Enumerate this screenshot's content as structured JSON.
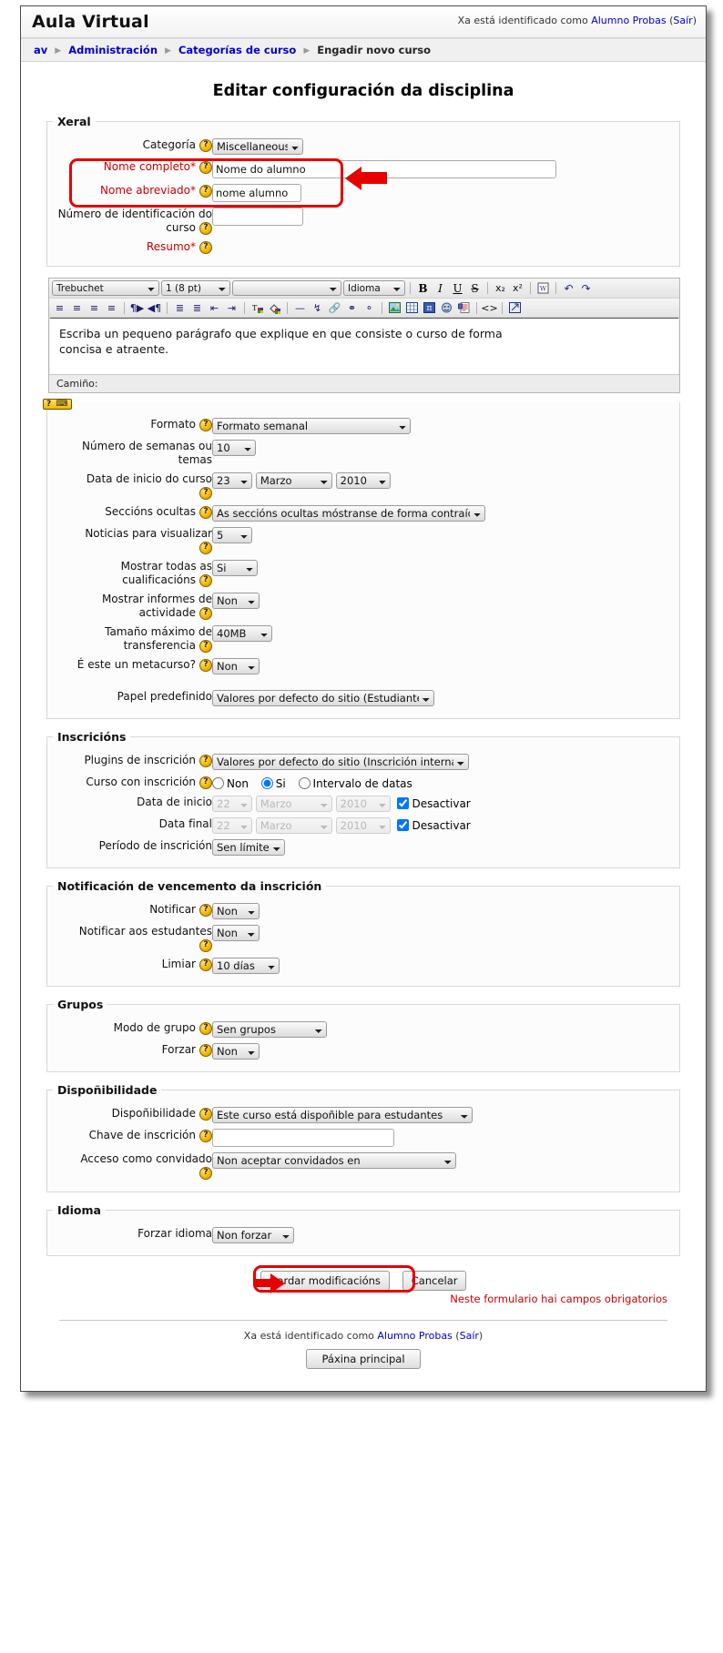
{
  "header": {
    "site_title": "Aula Virtual",
    "login_prefix": "Xa está identificado como",
    "user_name": "Alumno Probas",
    "logout_open": "(",
    "logout_label": "Saír",
    "logout_close": ")"
  },
  "breadcrumb": {
    "items": [
      {
        "label": "av",
        "link": true
      },
      {
        "label": "Administración",
        "link": true
      },
      {
        "label": "Categorías de curso",
        "link": true
      },
      {
        "label": "Engadir novo curso",
        "link": false
      }
    ],
    "separator": "▶"
  },
  "page": {
    "title": "Editar configuración da disciplina"
  },
  "sections": {
    "xeral": {
      "legend": "Xeral",
      "fields": {
        "categoria": {
          "label": "Categoría",
          "value": "Miscellaneous"
        },
        "nome_completo": {
          "label": "Nome completo",
          "star": "*",
          "value": "Nome do alumno"
        },
        "nome_abreviado": {
          "label": "Nome abreviado",
          "star": "*",
          "value": "nome alumno"
        },
        "numero_id": {
          "label": "Número de identificación do curso",
          "value": ""
        },
        "resumo": {
          "label": "Resumo",
          "star": "*"
        }
      }
    },
    "editor": {
      "font_family": "Trebuchet",
      "font_size": "1 (8 pt)",
      "format_block": "",
      "language": "Idioma",
      "buttons": {
        "bold": "B",
        "italic": "I",
        "underline": "U",
        "strike": "S",
        "subscript": "x₂",
        "superscript": "x²"
      },
      "path_label": "Camiño:",
      "kbd_help": "? ⌨",
      "content_line1": "Escriba un pequeno parágrafo que explique en que consiste o curso de forma",
      "content_line2": "concisa e atraente."
    },
    "xeral2": {
      "fields": {
        "formato": {
          "label": "Formato",
          "value": "Formato semanal"
        },
        "semanas": {
          "label": "Número de semanas ou temas",
          "value": "10"
        },
        "data_inicio": {
          "label": "Data de inicio do curso",
          "day": "23",
          "month": "Marzo",
          "year": "2010"
        },
        "seccions_ocultas": {
          "label": "Seccións ocultas",
          "value": "As seccións ocultas móstranse de forma contraída"
        },
        "noticias": {
          "label": "Noticias para visualizar",
          "value": "5"
        },
        "cualificacions": {
          "label": "Mostrar todas as cualificacións",
          "value": "Si"
        },
        "informes": {
          "label": "Mostrar informes de actividade",
          "value": "Non"
        },
        "tamano": {
          "label": "Tamaño máximo de transferencia",
          "value": "40MB"
        },
        "metacurso": {
          "label": "É este un metacurso?",
          "value": "Non"
        },
        "papel": {
          "label": "Papel predefinido",
          "value": "Valores por defecto do sitio (Estudiante)"
        }
      }
    },
    "inscricions": {
      "legend": "Inscricións",
      "fields": {
        "plugins": {
          "label": "Plugins de inscrición",
          "value": "Valores por defecto do sitio (Inscrición interna)"
        },
        "curso_con_inscricion": {
          "label": "Curso con inscrición",
          "options": [
            "Non",
            "Si",
            "Intervalo de datas"
          ],
          "selected": "Si"
        },
        "data_inicio": {
          "label": "Data de inicio",
          "day": "22",
          "month": "Marzo",
          "year": "2010",
          "disable_label": "Desactivar",
          "disabled_checked": true
        },
        "data_final": {
          "label": "Data final",
          "day": "22",
          "month": "Marzo",
          "year": "2010",
          "disable_label": "Desactivar",
          "disabled_checked": true
        },
        "periodo": {
          "label": "Período de inscrición",
          "value": "Sen límite"
        }
      }
    },
    "notificacion": {
      "legend": "Notificación de vencemento da inscrición",
      "fields": {
        "notificar": {
          "label": "Notificar",
          "value": "Non"
        },
        "notificar_estudantes": {
          "label": "Notificar aos estudantes",
          "value": "Non"
        },
        "limiar": {
          "label": "Limiar",
          "value": "10 días"
        }
      }
    },
    "grupos": {
      "legend": "Grupos",
      "fields": {
        "modo": {
          "label": "Modo de grupo",
          "value": "Sen grupos"
        },
        "forzar": {
          "label": "Forzar",
          "value": "Non"
        }
      }
    },
    "disponibilidade": {
      "legend": "Dispoñibilidade",
      "fields": {
        "disponibilidade": {
          "label": "Dispoñibilidade",
          "value": "Este curso está dispoñible para estudantes"
        },
        "chave": {
          "label": "Chave de inscrición",
          "value": ""
        },
        "convidado": {
          "label": "Acceso como convidado",
          "value": "Non aceptar convidados en"
        }
      }
    },
    "idioma": {
      "legend": "Idioma",
      "fields": {
        "forzar_idioma": {
          "label": "Forzar idioma",
          "value": "Non forzar"
        }
      }
    }
  },
  "actions": {
    "save_label": "Gardar modificacións",
    "cancel_label": "Cancelar",
    "required_note": "Neste formulario hai campos obrigatorios"
  },
  "footer": {
    "login_prefix": "Xa está identificado como",
    "user_name": "Alumno Probas",
    "logout_open": "(",
    "logout_label": "Saír",
    "logout_close": ")",
    "home_button": "Páxina principal"
  },
  "colors": {
    "annotation": "#e60000",
    "link": "#0000cc",
    "required": "#cc0000"
  }
}
